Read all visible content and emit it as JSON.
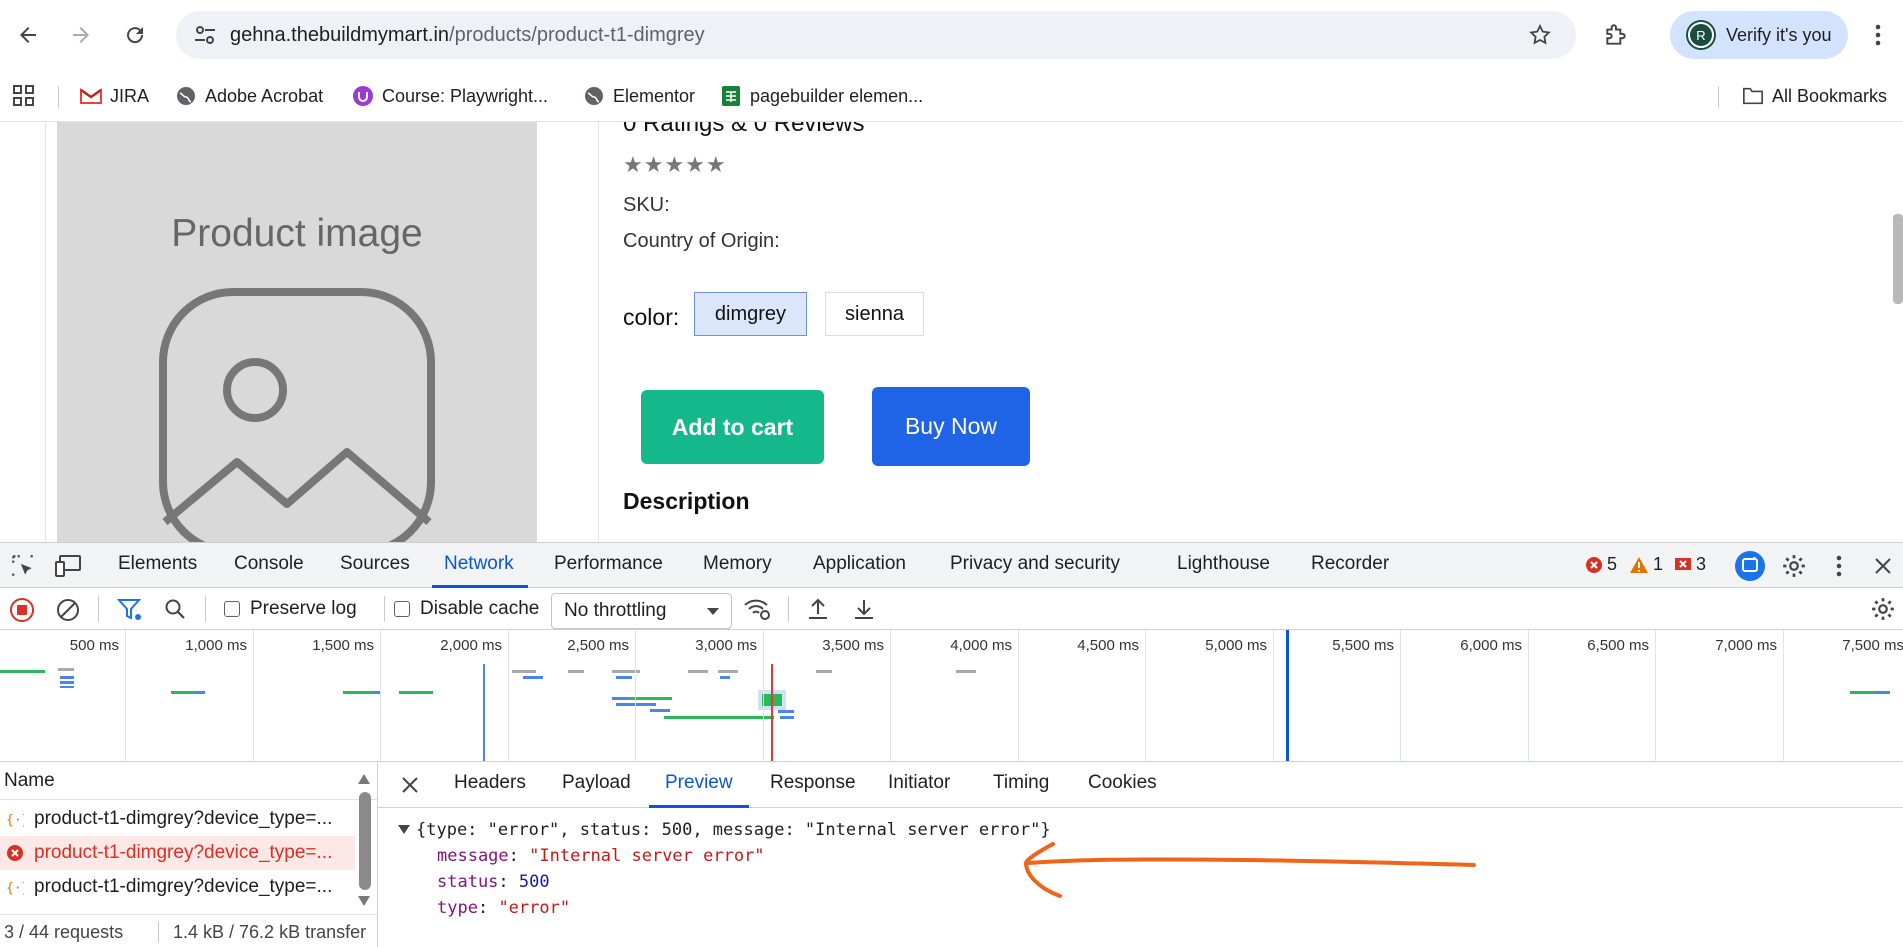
{
  "browser": {
    "url_host": "gehna.thebuildmymart.in",
    "url_path": "/products/product-t1-dimgrey",
    "verify_label": "Verify it's you",
    "avatar_letter": "R"
  },
  "bookmarks": {
    "items": [
      "JIRA",
      "Adobe Acrobat",
      "Course: Playwright...",
      "Elementor",
      "pagebuilder elemen..."
    ],
    "all_bookmarks": "All Bookmarks"
  },
  "product": {
    "image_label": "Product image",
    "ratings": "0 Ratings & 0 Reviews",
    "stars": "★★★★★",
    "sku_label": "SKU:",
    "origin_label": "Country of Origin:",
    "color_label": "color:",
    "colors": [
      "dimgrey",
      "sienna"
    ],
    "add_to_cart": "Add to cart",
    "buy_now": "Buy Now",
    "description_heading": "Description"
  },
  "devtools": {
    "tabs": [
      "Elements",
      "Console",
      "Sources",
      "Network",
      "Performance",
      "Memory",
      "Application",
      "Privacy and security",
      "Lighthouse",
      "Recorder"
    ],
    "active_tab": "Network",
    "error_count": "5",
    "warning_count": "1",
    "issue_count": "3",
    "toolbar": {
      "preserve_log": "Preserve log",
      "disable_cache": "Disable cache",
      "throttling": "No throttling"
    },
    "timeline_labels": [
      "500 ms",
      "1,000 ms",
      "1,500 ms",
      "2,000 ms",
      "2,500 ms",
      "3,000 ms",
      "3,500 ms",
      "4,000 ms",
      "4,500 ms",
      "5,000 ms",
      "5,500 ms",
      "6,000 ms",
      "6,500 ms",
      "7,000 ms",
      "7,500 ms"
    ],
    "requests": {
      "name_header": "Name",
      "rows": [
        "product-t1-dimgrey?device_type=...",
        "product-t1-dimgrey?device_type=...",
        "product-t1-dimgrey?device_type=..."
      ],
      "status_count": "3 / 44 requests",
      "status_size": "1.4 kB / 76.2 kB transfer"
    },
    "preview": {
      "tabs": [
        "Headers",
        "Payload",
        "Preview",
        "Response",
        "Initiator",
        "Timing",
        "Cookies"
      ],
      "active_tab": "Preview",
      "summary": "{type: \"error\", status: 500, message: \"Internal server error\"}",
      "message_key": "message",
      "message_value": "\"Internal server error\"",
      "status_key": "status",
      "status_value": "500",
      "type_key": "type",
      "type_value": "\"error\""
    }
  },
  "colors": {
    "accent_blue": "#0b57d0",
    "add_to_cart_green": "#14b88a",
    "buy_now_blue": "#1f63e6",
    "annotation_orange": "#f06418"
  }
}
